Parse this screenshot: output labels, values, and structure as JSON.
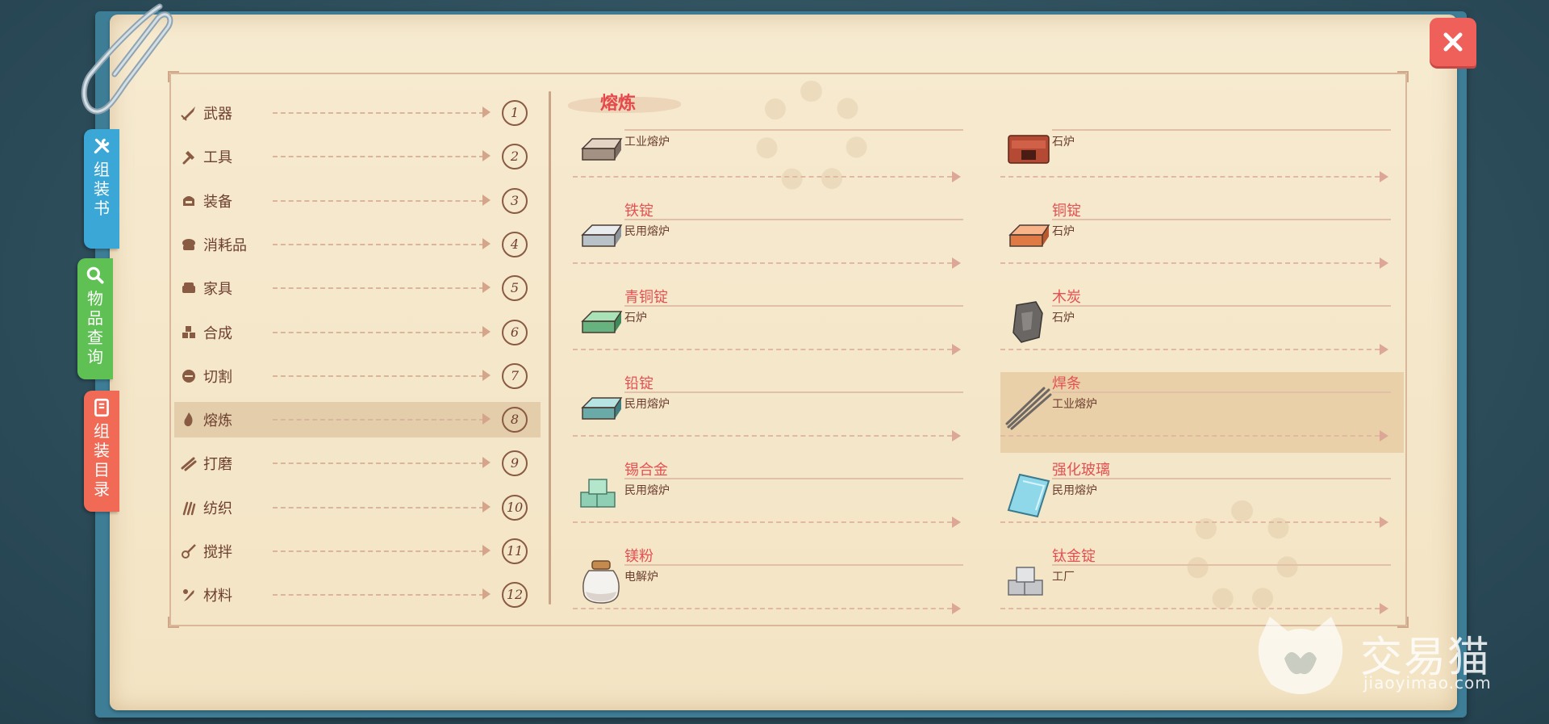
{
  "side_tabs": [
    {
      "label": "组装书"
    },
    {
      "label": "物品查询"
    },
    {
      "label": "组装目录"
    }
  ],
  "categories": [
    {
      "label": "武器",
      "num": "1"
    },
    {
      "label": "工具",
      "num": "2"
    },
    {
      "label": "装备",
      "num": "3"
    },
    {
      "label": "消耗品",
      "num": "4"
    },
    {
      "label": "家具",
      "num": "5"
    },
    {
      "label": "合成",
      "num": "6"
    },
    {
      "label": "切割",
      "num": "7"
    },
    {
      "label": "熔炼",
      "num": "8"
    },
    {
      "label": "打磨",
      "num": "9"
    },
    {
      "label": "纺织",
      "num": "10"
    },
    {
      "label": "搅拌",
      "num": "11"
    },
    {
      "label": "材料",
      "num": "12"
    }
  ],
  "selected_category": "熔炼",
  "section_title": "熔炼",
  "recipes_left": [
    {
      "name": "",
      "source": "工业熔炉",
      "icon": "industrial-furnace-icon"
    },
    {
      "name": "铁锭",
      "source": "民用熔炉",
      "icon": "iron-ingot-icon"
    },
    {
      "name": "青铜锭",
      "source": "石炉",
      "icon": "bronze-ingot-icon"
    },
    {
      "name": "铅锭",
      "source": "民用熔炉",
      "icon": "lead-ingot-icon"
    },
    {
      "name": "锡合金",
      "source": "民用熔炉",
      "icon": "tin-alloy-icon"
    },
    {
      "name": "镁粉",
      "source": "电解炉",
      "icon": "magnesium-powder-jar-icon"
    }
  ],
  "recipes_right": [
    {
      "name": "",
      "source": "石炉",
      "icon": "stone-furnace-icon"
    },
    {
      "name": "铜锭",
      "source": "石炉",
      "icon": "copper-ingot-icon"
    },
    {
      "name": "木炭",
      "source": "石炉",
      "icon": "charcoal-icon"
    },
    {
      "name": "焊条",
      "source": "工业熔炉",
      "icon": "welding-rod-icon"
    },
    {
      "name": "强化玻璃",
      "source": "民用熔炉",
      "icon": "reinforced-glass-icon"
    },
    {
      "name": "钛金锭",
      "source": "工厂",
      "icon": "titanium-ingot-icon"
    }
  ],
  "selected_recipe": "焊条",
  "close_label": "X",
  "watermark": {
    "text": "交易猫",
    "url": "jiaoyimao.com"
  },
  "colors": {
    "accent_red": "#e55152",
    "tab_blue": "#3aa7d6",
    "tab_green": "#5fc054",
    "tab_red": "#f06a55",
    "paper": "#f6ead0"
  }
}
